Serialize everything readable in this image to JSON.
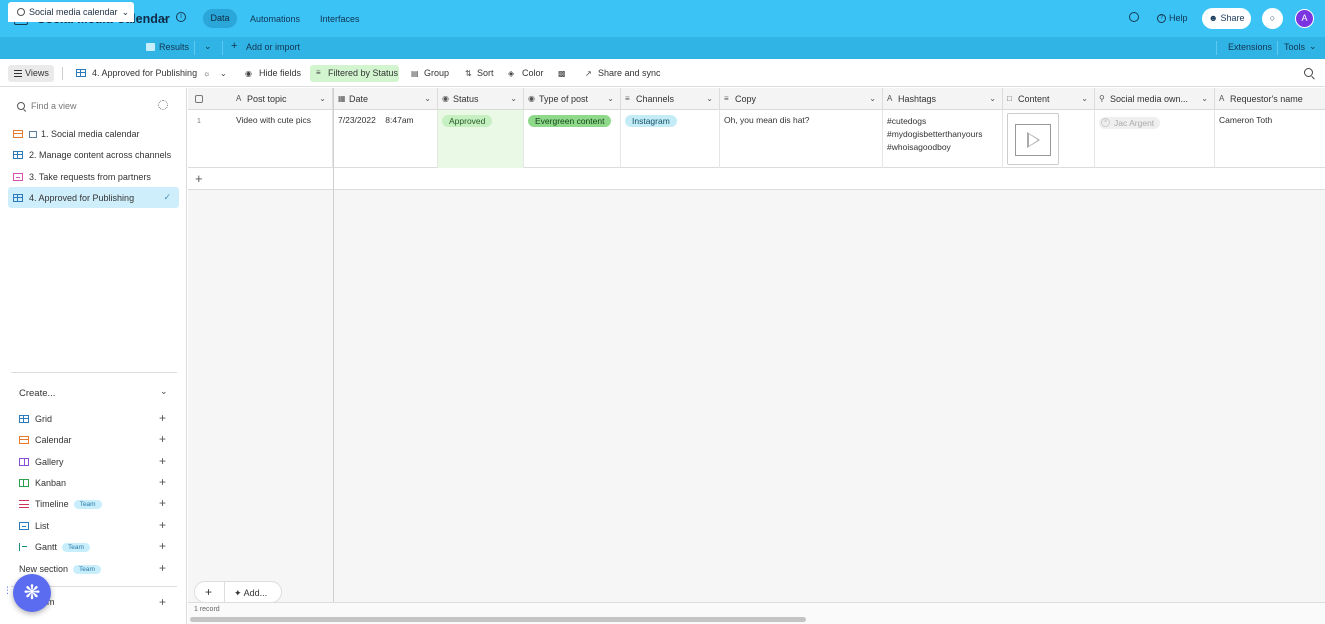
{
  "app": {
    "title": "Social Media Calendar",
    "nav": [
      "Data",
      "Automations",
      "Interfaces"
    ],
    "help": "Help",
    "share": "Share",
    "avatar_initial": "A"
  },
  "tabs": {
    "active": "Social media calendar",
    "results": "Results",
    "add_import": "Add or import",
    "extensions": "Extensions",
    "tools": "Tools"
  },
  "toolbar": {
    "views": "Views",
    "current_view": "4. Approved for Publishing",
    "hide_fields": "Hide fields",
    "filter": "Filtered by Status",
    "group": "Group",
    "sort": "Sort",
    "color": "Color",
    "share_sync": "Share and sync"
  },
  "sidebar": {
    "find_placeholder": "Find a view",
    "views": [
      "1. Social media calendar",
      "2. Manage content across channels",
      "3. Take requests from partners",
      "4. Approved for Publishing"
    ],
    "create_label": "Create...",
    "create_items": [
      {
        "label": "Grid",
        "badge": ""
      },
      {
        "label": "Calendar",
        "badge": ""
      },
      {
        "label": "Gallery",
        "badge": ""
      },
      {
        "label": "Kanban",
        "badge": ""
      },
      {
        "label": "Timeline",
        "badge": "Team"
      },
      {
        "label": "List",
        "badge": ""
      },
      {
        "label": "Gantt",
        "badge": "Team"
      },
      {
        "label": "New section",
        "badge": "Team"
      }
    ],
    "bottom_item": "m"
  },
  "grid": {
    "columns": [
      "Post topic",
      "Date",
      "Status",
      "Type of post",
      "Channels",
      "Copy",
      "Hashtags",
      "Content",
      "Social media own...",
      "Requestor's name"
    ],
    "row": {
      "num": "1",
      "post_topic": "Video with cute pics",
      "date": "7/23/2022",
      "time": "8:47am",
      "status": "Approved",
      "type": "Evergreen content",
      "channel": "Instagram",
      "copy": "Oh, you mean dis hat?",
      "hashtags": [
        "#cutedogs",
        "#mydogisbetterthanyours",
        "#whoisagoodboy"
      ],
      "owner": "Jac Argent",
      "requestor": "Cameron Toth"
    },
    "add_field": "Add...",
    "record_count": "1 record"
  },
  "colors": {
    "topbar": "#3bc3f6",
    "status_pill": "#c7f0c2",
    "type_pill": "#8fd98a",
    "channel_pill": "#c4ecf7"
  }
}
